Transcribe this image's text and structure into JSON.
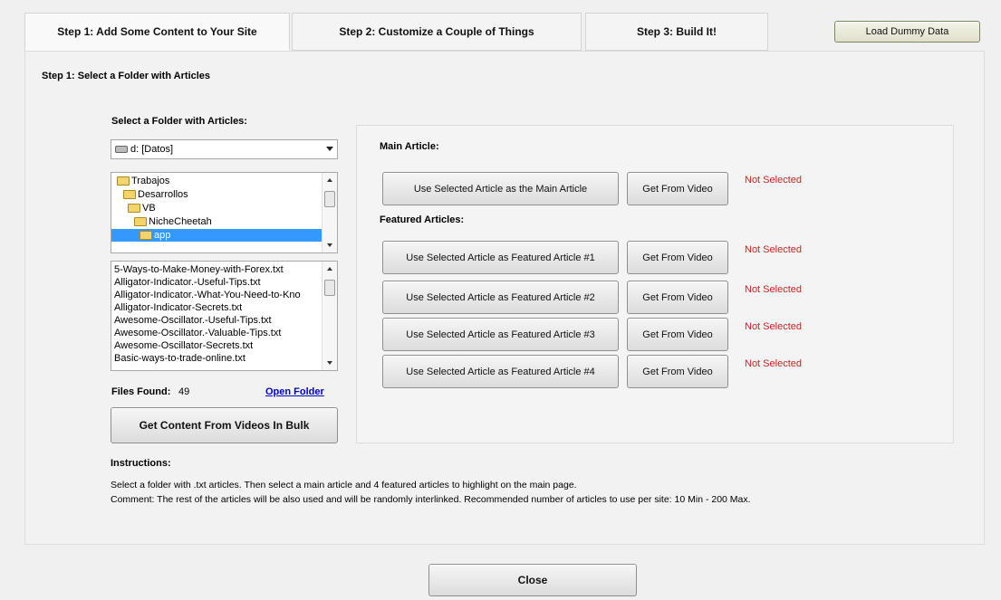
{
  "tabs": [
    {
      "label": "Step 1: Add Some Content to Your Site"
    },
    {
      "label": "Step 2: Customize a Couple of Things"
    },
    {
      "label": "Step 3: Build It!"
    }
  ],
  "load_dummy_label": "Load Dummy Data",
  "panel_title": "Step 1: Select a Folder with Articles",
  "folder_section": {
    "label": "Select a Folder with Articles:",
    "drive_value": "d: [Datos]",
    "folders": [
      "Trabajos",
      "Desarrollos",
      "VB",
      "NicheCheetah",
      "app"
    ],
    "files": [
      "5-Ways-to-Make-Money-with-Forex.txt",
      "Alligator-Indicator.-Useful-Tips.txt",
      "Alligator-Indicator.-What-You-Need-to-Kno",
      "Alligator-Indicator-Secrets.txt",
      "Awesome-Oscillator.-Useful-Tips.txt",
      "Awesome-Oscillator.-Valuable-Tips.txt",
      "Awesome-Oscillator-Secrets.txt",
      "Basic-ways-to-trade-online.txt"
    ],
    "files_found_label": "Files Found:",
    "files_found_count": "49",
    "open_folder_label": "Open Folder",
    "bulk_button_label": "Get Content From Videos In Bulk"
  },
  "main_article": {
    "heading": "Main Article:",
    "button_label": "Use Selected Article as the Main Article",
    "video_label": "Get From Video",
    "status": "Not Selected"
  },
  "featured": {
    "heading": "Featured Articles:",
    "items": [
      {
        "button_label": "Use Selected Article as Featured Article #1",
        "video_label": "Get From Video",
        "status": "Not Selected"
      },
      {
        "button_label": "Use Selected Article as Featured Article #2",
        "video_label": "Get From Video",
        "status": "Not Selected"
      },
      {
        "button_label": "Use Selected Article as Featured Article #3",
        "video_label": "Get From Video",
        "status": "Not Selected"
      },
      {
        "button_label": "Use Selected Article as Featured Article #4",
        "video_label": "Get From Video",
        "status": "Not Selected"
      }
    ]
  },
  "instructions": {
    "heading": "Instructions:",
    "line1": "Select a folder with .txt articles. Then select a main article and 4 featured articles to highlight on the main page.",
    "line2": "Comment: The rest of the articles will be also used and will be randomly interlinked.  Recommended number of articles to use per site: 10 Min - 200 Max."
  },
  "close_label": "Close",
  "colors": {
    "status_red": "#cc2222",
    "selection_blue": "#3399ff",
    "link_blue": "#0000cc"
  }
}
